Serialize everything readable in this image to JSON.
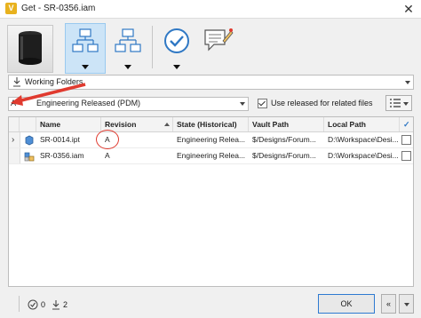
{
  "window": {
    "title": "Get - SR-0356.iam",
    "app_icon": "vault-icon",
    "close_glyph": "✕"
  },
  "toolbar": {
    "thumbnail": "part-thumbnail",
    "buttons": [
      {
        "name": "parents-dependency-button",
        "icon": "hierarchy-down-icon",
        "active": true
      },
      {
        "name": "children-dependency-button",
        "icon": "hierarchy-up-icon",
        "active": false
      },
      {
        "name": "check-button",
        "icon": "checkmark-circle-icon",
        "active": false
      },
      {
        "name": "comment-button",
        "icon": "comment-edit-icon",
        "active": false
      }
    ]
  },
  "working_folders": {
    "label": "Working Folders"
  },
  "revision_filter": {
    "prefix": "A",
    "value": "Engineering Released (PDM)"
  },
  "use_released": {
    "label": "Use released for related files",
    "checked": true
  },
  "grid": {
    "columns": [
      "Name",
      "Revision",
      "State (Historical)",
      "Vault Path",
      "Local Path"
    ],
    "rows": [
      {
        "name": "SR-0014.ipt",
        "revision": "A",
        "state": "Engineering Relea...",
        "vault_path": "$/Designs/Forum...",
        "local_path": "D:\\Workspace\\Desi...",
        "checked": false,
        "icon": "part-file-icon",
        "expand": "›"
      },
      {
        "name": "SR-0356.iam",
        "revision": "A",
        "state": "Engineering Relea...",
        "vault_path": "$/Designs/Forum...",
        "local_path": "D:\\Workspace\\Desi...",
        "checked": false,
        "icon": "assembly-file-icon",
        "expand": ""
      }
    ]
  },
  "status": {
    "check_count": "0",
    "download_count": "2"
  },
  "actions": {
    "ok": "OK",
    "collapse": "«"
  },
  "colors": {
    "accent": "#2e7ad1",
    "annotation": "#e03a2f",
    "active_bg": "#cce4f7"
  }
}
